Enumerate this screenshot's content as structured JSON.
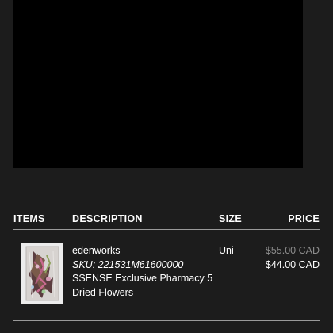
{
  "table": {
    "headers": {
      "items": "ITEMS",
      "description": "DESCRIPTION",
      "size": "SIZE",
      "price": "PRICE"
    },
    "rows": [
      {
        "brand": "edenworks",
        "sku": "SKU: 221531M61600000",
        "name_line1": "SSENSE Exclusive Pharmacy 5",
        "name_line2": "Dried Flowers",
        "size": "Uni",
        "original_price": "$55.00 CAD",
        "sale_price": "$44.00 CAD"
      }
    ]
  },
  "colors": {
    "background": "#1c1c1c",
    "hero": "#000000",
    "text": "#ffffff",
    "muted": "#8d8d8d",
    "rule": "#9a9a9a"
  }
}
